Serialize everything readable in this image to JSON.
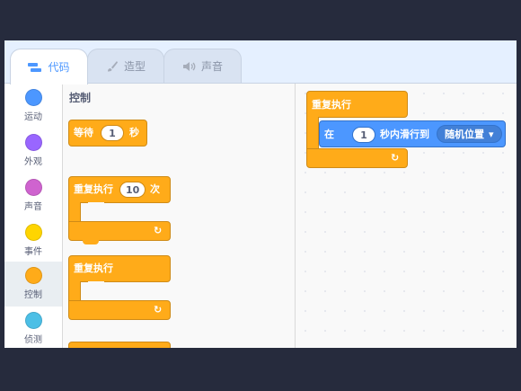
{
  "tabs": [
    {
      "label": "代码",
      "icon": "code-icon",
      "active": true
    },
    {
      "label": "造型",
      "icon": "paintbrush-icon",
      "active": false
    },
    {
      "label": "声音",
      "icon": "speaker-icon",
      "active": false
    }
  ],
  "categories": [
    {
      "label": "运动",
      "color": "#4c97ff"
    },
    {
      "label": "外观",
      "color": "#9966ff"
    },
    {
      "label": "声音",
      "color": "#cf63cf"
    },
    {
      "label": "事件",
      "color": "#ffd500"
    },
    {
      "label": "控制",
      "color": "#ffab19",
      "active": true
    },
    {
      "label": "侦测",
      "color": "#4cbfe6"
    }
  ],
  "palette": {
    "title": "控制",
    "wait": {
      "label": "等待",
      "value": "1",
      "unit": "秒"
    },
    "repeat": {
      "label": "重复执行",
      "value": "10",
      "unit": "次"
    },
    "forever": {
      "label": "重复执行"
    },
    "loop_arrow": "↻"
  },
  "script": {
    "forever_label": "重复执行",
    "glide": {
      "prefix": "在",
      "value": "1",
      "middle": "秒内滑行到",
      "target": "随机位置",
      "caret": "▾"
    },
    "loop_arrow": "↻"
  },
  "colors": {
    "control": "#ffab19",
    "motion": "#4c97ff",
    "accent": "#4c97ff"
  }
}
